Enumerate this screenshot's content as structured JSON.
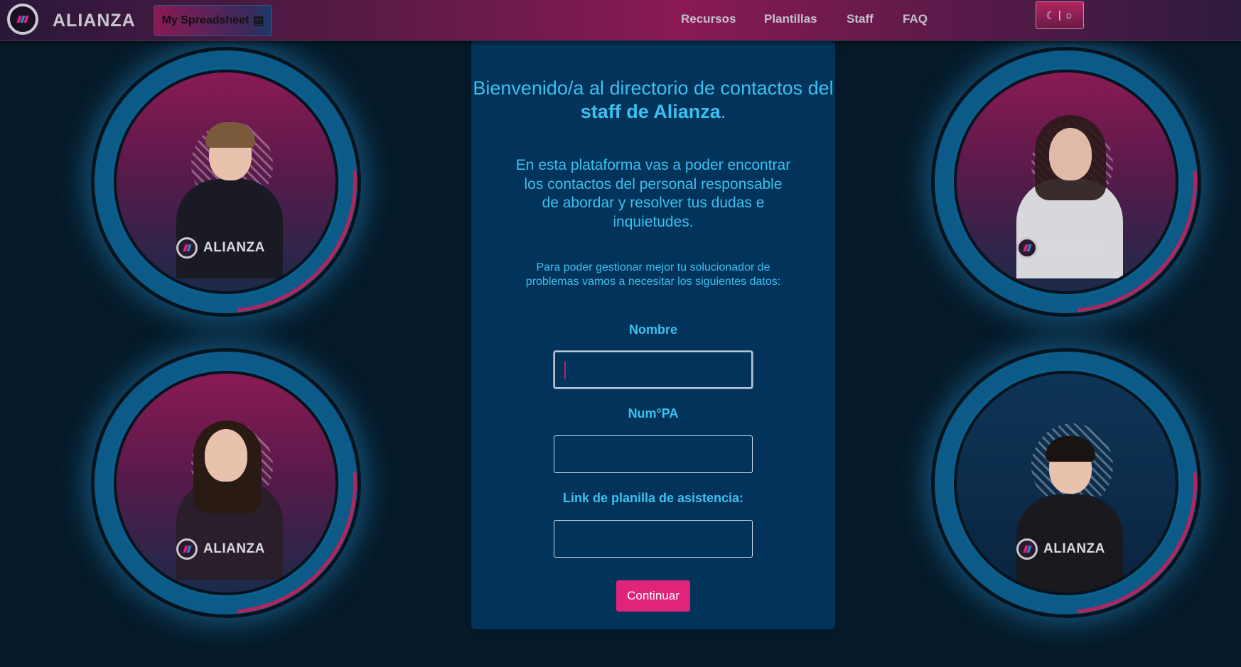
{
  "nav": {
    "brand": "ALIANZA",
    "spreadsheet_button": "My Spreadsheet",
    "spreadsheet_icon": "id-card-icon",
    "links": [
      "Recursos",
      "Plantillas",
      "Staff",
      "FAQ"
    ],
    "theme_toggle": {
      "moon": "☾",
      "separator": "|",
      "sun": "☼"
    }
  },
  "panel": {
    "welcome_prefix": "Bienvenido/a al directorio de contactos del ",
    "welcome_bold": "staff de Alianza",
    "welcome_suffix": ".",
    "description": "En esta plataforma vas a poder encontrar los contactos del personal responsable de abordar y resolver tus dudas e inquietudes.",
    "note": "Para poder gestionar mejor tu solucionador de problemas vamos a necesitar los siguientes datos:",
    "fields": [
      {
        "label": "Nombre",
        "value": ""
      },
      {
        "label": "Num°PA",
        "value": ""
      },
      {
        "label": "Link de planilla de asistencia:",
        "value": ""
      }
    ],
    "submit_label": "Continuar"
  },
  "avatars": [
    {
      "brand": "ALIANZA"
    },
    {
      "brand": "ALIANZA"
    },
    {
      "brand": "ALIANZA"
    },
    {
      "brand": "ALIANZA"
    }
  ],
  "colors": {
    "accent": "#e0247a",
    "text_cyan": "#3cc0ee",
    "panel": "#02335a",
    "background": "#051a28"
  }
}
